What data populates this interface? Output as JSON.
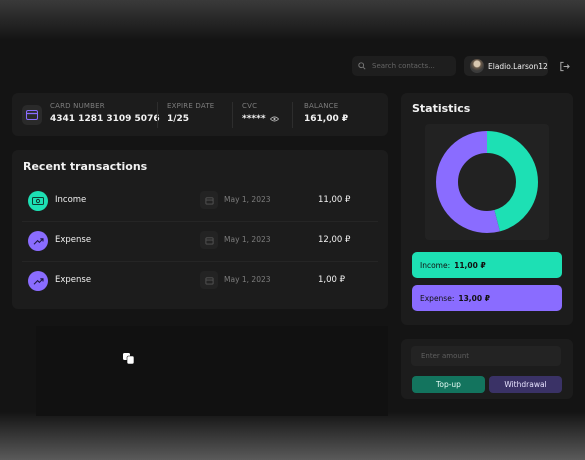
{
  "header": {
    "search_placeholder": "Search contacts...",
    "username": "Eladio.Larson12"
  },
  "card": {
    "number_label": "CARD NUMBER",
    "number": "4341 1281 3109 5076",
    "expire_label": "EXPIRE DATE",
    "expire": "1/25",
    "cvc_label": "CVC",
    "cvc": "*****",
    "balance_label": "BALANCE",
    "balance": "161,00 ₽"
  },
  "transactions": {
    "title": "Recent transactions",
    "rows": [
      {
        "type": "Income",
        "date": "May 1, 2023",
        "amount": "11,00 ₽"
      },
      {
        "type": "Expense",
        "date": "May 1, 2023",
        "amount": "12,00 ₽"
      },
      {
        "type": "Expense",
        "date": "May 1, 2023",
        "amount": "1,00 ₽"
      }
    ]
  },
  "statistics": {
    "title": "Statistics",
    "income_label": "Income:",
    "income_value": "11,00 ₽",
    "expense_label": "Expense:",
    "expense_value": "13,00 ₽"
  },
  "chart_data": {
    "type": "pie",
    "categories": [
      "Income",
      "Expense"
    ],
    "values": [
      11,
      13
    ],
    "colors": [
      "#1de0b4",
      "#8a6cff"
    ]
  },
  "topup": {
    "amount_placeholder": "Enter amount",
    "topup_label": "Top-up",
    "withdrawal_label": "Withdrawal"
  },
  "colors": {
    "income": "#1de0b4",
    "expense": "#8a6cff",
    "topup_button": "#13745e",
    "withdrawal_button": "#3a3266"
  }
}
